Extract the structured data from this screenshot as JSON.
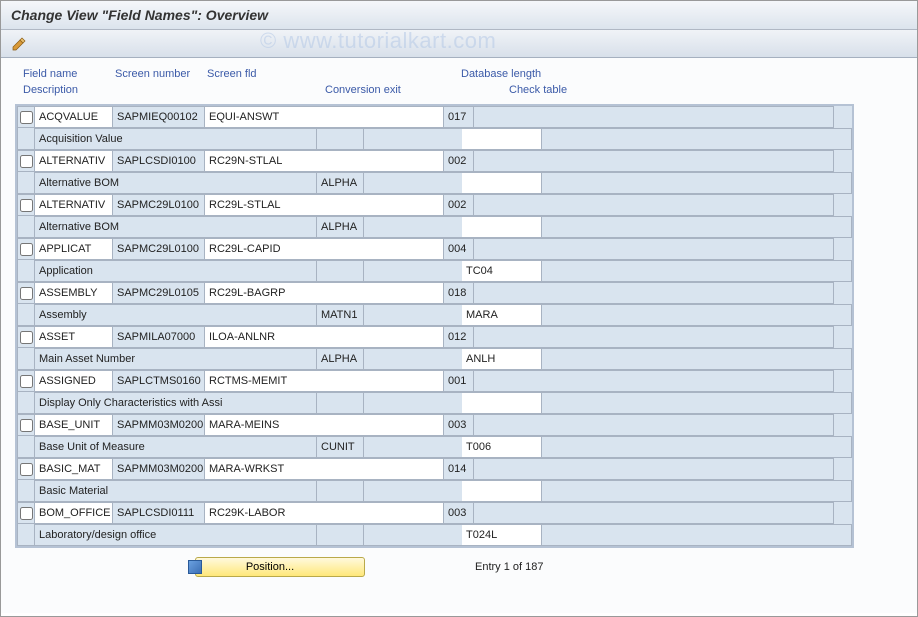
{
  "title": "Change View \"Field Names\": Overview",
  "watermark": "© www.tutorialkart.com",
  "headers": {
    "field": "Field name",
    "screen": "Screen number",
    "fld": "Screen fld",
    "db": "Database length",
    "desc": "Description",
    "conv": "Conversion exit",
    "check": "Check table"
  },
  "entries": [
    {
      "field": "ACQVALUE",
      "screen": "SAPMIEQ00102",
      "fld": "EQUI-ANSWT",
      "dblen": "017",
      "desc": "Acquisition Value",
      "conv": "",
      "check": ""
    },
    {
      "field": "ALTERNATIV",
      "screen": "SAPLCSDI0100",
      "fld": "RC29N-STLAL",
      "dblen": "002",
      "desc": "Alternative BOM",
      "conv": "ALPHA",
      "check": ""
    },
    {
      "field": "ALTERNATIV",
      "screen": "SAPMC29L0100",
      "fld": "RC29L-STLAL",
      "dblen": "002",
      "desc": "Alternative BOM",
      "conv": "ALPHA",
      "check": ""
    },
    {
      "field": "APPLICAT",
      "screen": "SAPMC29L0100",
      "fld": "RC29L-CAPID",
      "dblen": "004",
      "desc": "Application",
      "conv": "",
      "check": "TC04"
    },
    {
      "field": "ASSEMBLY",
      "screen": "SAPMC29L0105",
      "fld": "RC29L-BAGRP",
      "dblen": "018",
      "desc": "Assembly",
      "conv": "MATN1",
      "check": "MARA"
    },
    {
      "field": "ASSET",
      "screen": "SAPMILA07000",
      "fld": "ILOA-ANLNR",
      "dblen": "012",
      "desc": "Main Asset Number",
      "conv": "ALPHA",
      "check": "ANLH"
    },
    {
      "field": "ASSIGNED",
      "screen": "SAPLCTMS0160",
      "fld": "RCTMS-MEMIT",
      "dblen": "001",
      "desc": "Display Only Characteristics with Assi",
      "conv": "",
      "check": ""
    },
    {
      "field": "BASE_UNIT",
      "screen": "SAPMM03M0200",
      "fld": "MARA-MEINS",
      "dblen": "003",
      "desc": "Base Unit of Measure",
      "conv": "CUNIT",
      "check": "T006"
    },
    {
      "field": "BASIC_MAT",
      "screen": "SAPMM03M0200",
      "fld": "MARA-WRKST",
      "dblen": "014",
      "desc": "Basic Material",
      "conv": "",
      "check": ""
    },
    {
      "field": "BOM_OFFICE",
      "screen": "SAPLCSDI0111",
      "fld": "RC29K-LABOR",
      "dblen": "003",
      "desc": "Laboratory/design office",
      "conv": "",
      "check": "T024L"
    }
  ],
  "footer": {
    "position_btn": "Position...",
    "entry_text": "Entry 1 of 187"
  }
}
